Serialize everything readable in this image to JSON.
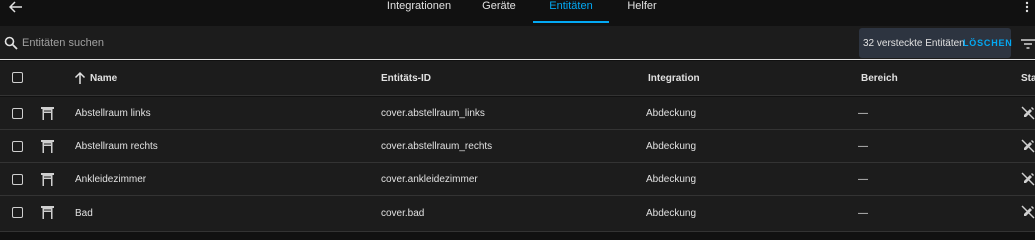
{
  "topbar": {
    "tabs": [
      {
        "label": "Integrationen",
        "active": false
      },
      {
        "label": "Geräte",
        "active": false
      },
      {
        "label": "Entitäten",
        "active": true
      },
      {
        "label": "Helfer",
        "active": false
      }
    ]
  },
  "search": {
    "placeholder": "Entitäten suchen",
    "hidden_count_text": "32 versteckte Entitäten",
    "clear_label": "LÖSCHEN"
  },
  "table": {
    "columns": {
      "name": "Name",
      "entity_id": "Entitäts-ID",
      "integration": "Integration",
      "area": "Bereich",
      "status": "Status"
    },
    "rows": [
      {
        "name": "Abstellraum links",
        "entity_id": "cover.abstellraum_links",
        "integration": "Abdeckung",
        "area": "—"
      },
      {
        "name": "Abstellraum rechts",
        "entity_id": "cover.abstellraum_rechts",
        "integration": "Abdeckung",
        "area": "—"
      },
      {
        "name": "Ankleidezimmer",
        "entity_id": "cover.ankleidezimmer",
        "integration": "Abdeckung",
        "area": "—"
      },
      {
        "name": "Bad",
        "entity_id": "cover.bad",
        "integration": "Abdeckung",
        "area": "—"
      }
    ]
  },
  "colors": {
    "accent": "#03a9f4",
    "background": "#111111",
    "surface": "#1c1c1c"
  },
  "icons": {
    "back": "arrow-left-icon",
    "search": "magnify-icon",
    "filter": "filter-icon",
    "sort": "arrow-up-icon",
    "row": "window-shutter-icon",
    "status": "pencil-off-icon",
    "menu": "dots-vertical-icon"
  }
}
